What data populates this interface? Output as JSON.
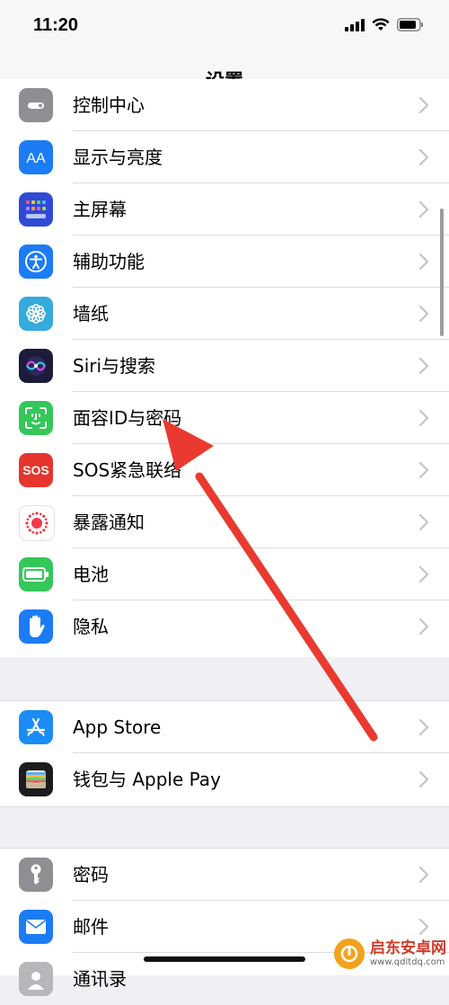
{
  "status_bar": {
    "time": "11:20"
  },
  "nav": {
    "title": "设置"
  },
  "groups": [
    {
      "items": [
        {
          "label": "控制中心",
          "icon": "control-center-icon",
          "color": "#8e8e93"
        },
        {
          "label": "显示与亮度",
          "icon": "display-icon",
          "color": "#1b7cf5"
        },
        {
          "label": "主屏幕",
          "icon": "home-screen-icon",
          "color": "#2f4bd6"
        },
        {
          "label": "辅助功能",
          "icon": "accessibility-icon",
          "color": "#1b7cf5"
        },
        {
          "label": "墙纸",
          "icon": "wallpaper-icon",
          "color": "#35aadc"
        },
        {
          "label": "Siri与搜索",
          "icon": "siri-icon",
          "color": "#1c1c3a"
        },
        {
          "label": "面容ID与密码",
          "icon": "face-id-icon",
          "color": "#34c759"
        },
        {
          "label": "SOS紧急联络",
          "icon": "sos-icon",
          "color": "#e5352d",
          "icon_text": "SOS"
        },
        {
          "label": "暴露通知",
          "icon": "exposure-icon",
          "color": "#ffffff"
        },
        {
          "label": "电池",
          "icon": "battery-icon",
          "color": "#34c759"
        },
        {
          "label": "隐私",
          "icon": "privacy-hand-icon",
          "color": "#1b7cf5"
        }
      ]
    },
    {
      "items": [
        {
          "label": "App Store",
          "icon": "app-store-icon",
          "color": "#1b8cf5"
        },
        {
          "label": "钱包与 Apple Pay",
          "icon": "wallet-icon",
          "color": "#1c1c1e"
        }
      ]
    },
    {
      "items": [
        {
          "label": "密码",
          "icon": "key-icon",
          "color": "#8e8e93"
        },
        {
          "label": "邮件",
          "icon": "mail-icon",
          "color": "#1b7cf5"
        },
        {
          "label": "通讯录",
          "icon": "contacts-icon",
          "color": "#b7b7bb"
        }
      ]
    }
  ],
  "watermark": {
    "main": "启东安卓网",
    "sub": "www.qdltdq.com"
  }
}
